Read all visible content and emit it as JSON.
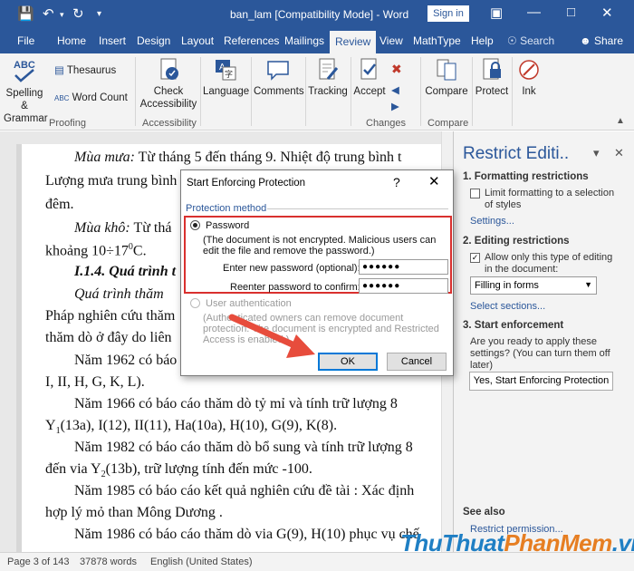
{
  "window": {
    "title": "ban_lam [Compatibility Mode] - Word",
    "sign_in": "Sign in"
  },
  "tabs": [
    "File",
    "Home",
    "Insert",
    "Design",
    "Layout",
    "References",
    "Mailings",
    "Review",
    "View",
    "MathType",
    "Help"
  ],
  "tell_me": "Search",
  "share": "Share",
  "ribbon": {
    "spelling": "Spelling &",
    "grammar": "Grammar",
    "thesaurus": "Thesaurus",
    "word_count": "Word Count",
    "proofing": "Proofing",
    "check": "Check",
    "accessibility": "Accessibility",
    "accessibility_group": "Accessibility",
    "language": "Language",
    "comments": "Comments",
    "tracking": "Tracking",
    "accept": "Accept",
    "changes": "Changes",
    "compare": "Compare",
    "compare_group": "Compare",
    "protect": "Protect",
    "ink": "Ink"
  },
  "document": {
    "l1a": "Mùa mưa:",
    "l1b": " Từ tháng 5 đến tháng 9. Nhiệt độ trung bình t",
    "l2": "Lượng mưa trung bình",
    "l3": "đêm.",
    "l4a": "Mùa khô:",
    "l4b": " Từ thá",
    "l5a": "khoảng 10÷17",
    "l5sup": "0",
    "l5b": "C.",
    "l6": "I.1.4. Quá trình t",
    "l7": "Quá trình thăm",
    "l8": "Pháp nghiên cứu thăm",
    "l9": "thăm dò ở đây do liên",
    "l10": "Năm 1962 có báo",
    "l11": "I, II, H, G, K, L).",
    "l12": "Năm 1966 có báo cáo thăm dò tỷ mỉ và tính trữ lượng 8",
    "l13a": "Y",
    "l13s": "1",
    "l13b": "(13a), I(12), II(11), Ha(10a), H(10), G(9), K(8).",
    "l14": "Năm 1982 có báo cáo thăm dò bổ sung và tính trữ lượng 8",
    "l15a": "đến via Y",
    "l15s": "2",
    "l15b": "(13b), trữ lượng tính đến mức -100.",
    "l16": "Năm 1985 có báo cáo kết quả nghiên cứu đề tài : Xác định",
    "l17": "hợp lý mỏ than Mông Dương .",
    "l18": "Năm 1986 có báo cáo thăm dò via G(9), H(10) phục vụ chế"
  },
  "pane": {
    "title": "Restrict Editi..",
    "h1": "1. Formatting restrictions",
    "limit": "Limit formatting to a selection of styles",
    "settings": "Settings...",
    "h2": "2. Editing restrictions",
    "allow": "Allow only this type of editing in the document:",
    "filling": "Filling in forms",
    "select_sections": "Select sections...",
    "h3": "3. Start enforcement",
    "ready": "Are you ready to apply these settings? (You can turn them off later)",
    "yes_button": "Yes, Start Enforcing Protection",
    "see_also": "See also",
    "restrict_permission": "Restrict permission..."
  },
  "dialog": {
    "title": "Start Enforcing Protection",
    "help": "?",
    "method": "Protection method",
    "password": "Password",
    "note": "(The document is not encrypted. Malicious users can edit the file and remove the password.)",
    "enter_label": "Enter new password (optional):",
    "enter_value": "●●●●●●",
    "reenter_label": "Reenter password to confirm:",
    "reenter_value": "●●●●●●",
    "user_auth": "User authentication",
    "auth_note": "(Authenticated owners can remove document protection. The document is encrypted and Restricted Access is enabled.)",
    "ok": "OK",
    "cancel": "Cancel"
  },
  "status": {
    "page": "Page 3 of 143",
    "words": "37878 words",
    "language": "English (United States)"
  },
  "watermark": {
    "a": "ThuThuat",
    "b": "PhanMem",
    "c": ".vn"
  },
  "colors": {
    "word_blue": "#2b579a",
    "highlight_red": "#d9302e",
    "arrow_red": "#e74c3c"
  }
}
